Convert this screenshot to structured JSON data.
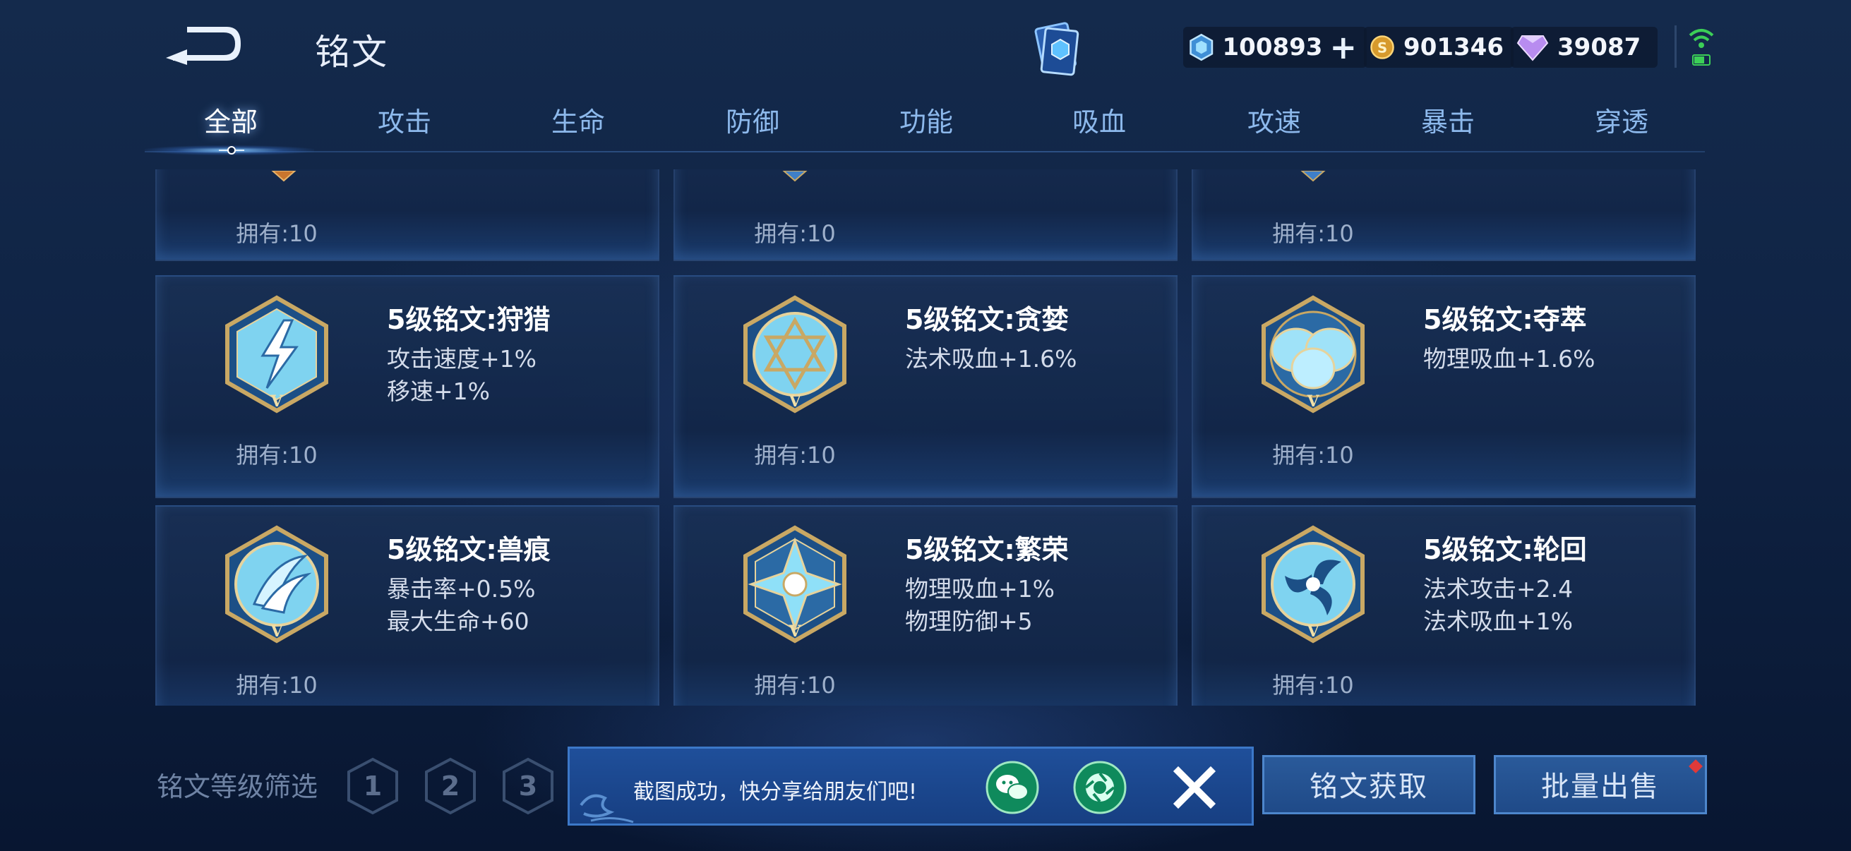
{
  "header": {
    "title": "铭文",
    "currencies": [
      {
        "icon": "crystal-coupon-icon",
        "value": "100893",
        "has_plus": true
      },
      {
        "icon": "gold-coin-icon",
        "value": "901346"
      },
      {
        "icon": "diamond-icon",
        "value": "39087"
      }
    ]
  },
  "tabs": [
    "全部",
    "攻击",
    "生命",
    "防御",
    "功能",
    "吸血",
    "攻速",
    "暴击",
    "穿透"
  ],
  "active_tab": "全部",
  "top_row_partial": [
    {
      "owned": "拥有:10"
    },
    {
      "owned": "拥有:10"
    },
    {
      "owned": "拥有:10"
    }
  ],
  "cards": [
    {
      "name": "5级铭文:狩猎",
      "attrs": [
        "攻击速度+1%",
        "移速+1%"
      ],
      "owned": "拥有:10",
      "emblem": "lightning-emblem-icon"
    },
    {
      "name": "5级铭文:贪婪",
      "attrs": [
        "法术吸血+1.6%"
      ],
      "owned": "拥有:10",
      "emblem": "star-emblem-icon"
    },
    {
      "name": "5级铭文:夺萃",
      "attrs": [
        "物理吸血+1.6%"
      ],
      "owned": "拥有:10",
      "emblem": "knot-emblem-icon"
    },
    {
      "name": "5级铭文:兽痕",
      "attrs": [
        "暴击率+0.5%",
        "最大生命+60"
      ],
      "owned": "拥有:10",
      "emblem": "claw-emblem-icon"
    },
    {
      "name": "5级铭文:繁荣",
      "attrs": [
        "物理吸血+1%",
        "物理防御+5"
      ],
      "owned": "拥有:10",
      "emblem": "cross-emblem-icon"
    },
    {
      "name": "5级铭文:轮回",
      "attrs": [
        "法术攻击+2.4",
        "法术吸血+1%"
      ],
      "owned": "拥有:10",
      "emblem": "swirl-emblem-icon"
    }
  ],
  "level_filter": {
    "label": "铭文等级筛选",
    "levels": [
      "1",
      "2",
      "3"
    ]
  },
  "toast": {
    "message": "截图成功，快分享给朋友们吧!"
  },
  "buttons": {
    "acquire": "铭文获取",
    "sell": "批量出售"
  },
  "colors": {
    "tab_inactive": "#8db9ec",
    "tab_active": "#ffffff",
    "emblem_blue": "#7fd3f0",
    "emblem_gold": "#c9a864",
    "toast_bg": "#1f4f9a"
  }
}
